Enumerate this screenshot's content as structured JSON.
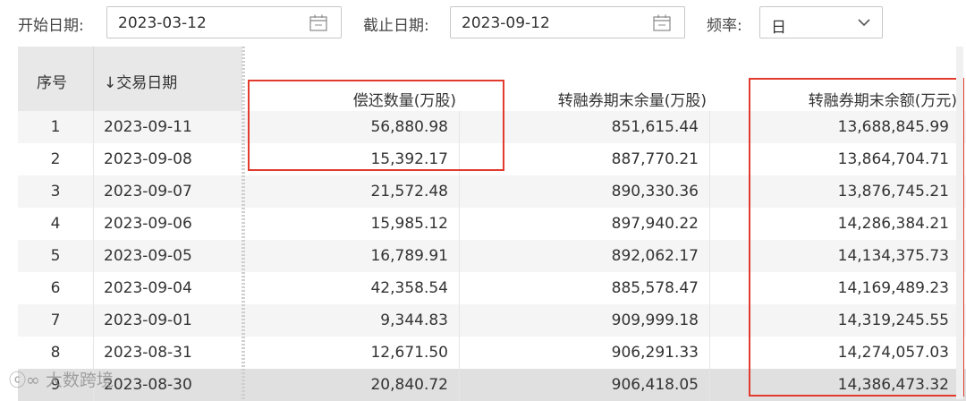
{
  "filters": {
    "start_label": "开始日期:",
    "start_value": "2023-03-12",
    "end_label": "截止日期:",
    "end_value": "2023-09-12",
    "freq_label": "频率:",
    "freq_value": "日"
  },
  "table": {
    "headers": {
      "idx": "序号",
      "date": "↓交易日期",
      "repay": "偿还数量(万股)",
      "vol": "转融券期末余量(万股)",
      "amt": "转融券期末余额(万元)"
    },
    "rows": [
      {
        "idx": "1",
        "date": "2023-09-11",
        "repay": "56,880.98",
        "vol": "851,615.44",
        "amt": "13,688,845.99"
      },
      {
        "idx": "2",
        "date": "2023-09-08",
        "repay": "15,392.17",
        "vol": "887,770.21",
        "amt": "13,864,704.71"
      },
      {
        "idx": "3",
        "date": "2023-09-07",
        "repay": "21,572.48",
        "vol": "890,330.36",
        "amt": "13,876,745.21"
      },
      {
        "idx": "4",
        "date": "2023-09-06",
        "repay": "15,985.12",
        "vol": "897,940.22",
        "amt": "14,286,384.21"
      },
      {
        "idx": "5",
        "date": "2023-09-05",
        "repay": "16,789.91",
        "vol": "892,062.17",
        "amt": "14,134,375.73"
      },
      {
        "idx": "6",
        "date": "2023-09-04",
        "repay": "42,358.54",
        "vol": "885,578.47",
        "amt": "14,169,489.23"
      },
      {
        "idx": "7",
        "date": "2023-09-01",
        "repay": "9,344.83",
        "vol": "909,999.18",
        "amt": "14,319,245.55"
      },
      {
        "idx": "8",
        "date": "2023-08-31",
        "repay": "12,671.50",
        "vol": "906,291.33",
        "amt": "14,274,057.03"
      },
      {
        "idx": "9",
        "date": "2023-08-30",
        "repay": "20,840.72",
        "vol": "906,418.05",
        "amt": "14,386,473.32"
      }
    ]
  },
  "watermark": "大数跨境",
  "colors": {
    "highlight": "#e23b2e",
    "header_bg": "#e8e8e8",
    "row_even": "#f5f5f5",
    "row_selected": "#e0e0e0"
  }
}
